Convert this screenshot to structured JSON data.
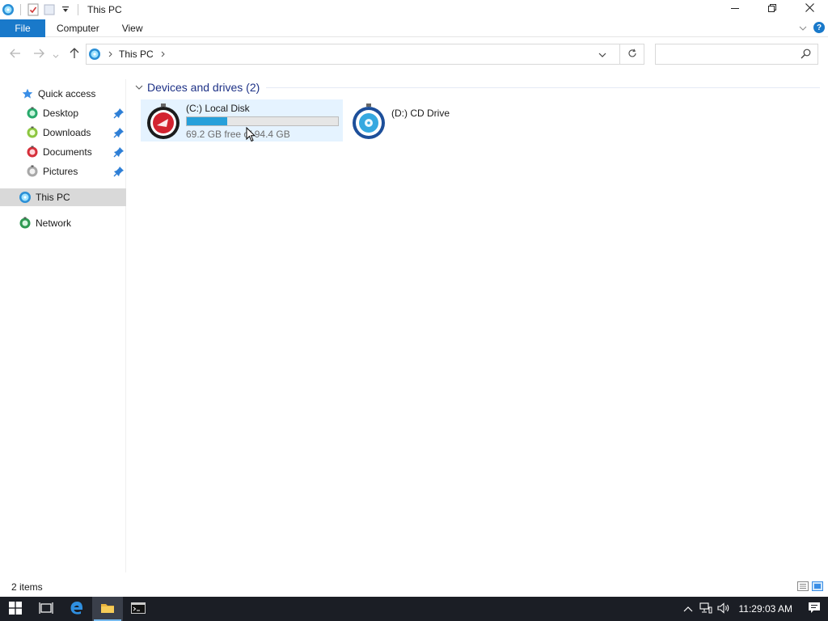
{
  "window": {
    "title": "This PC",
    "icon": "this-pc-icon",
    "controls": [
      "minimize-icon",
      "restore-icon",
      "close-icon"
    ]
  },
  "quick_access_toolbar": {
    "items": [
      "properties-icon",
      "new-folder-icon",
      "customize-dropdown-icon"
    ]
  },
  "ribbon": {
    "tabs": [
      {
        "label": "File",
        "active": true
      },
      {
        "label": "Computer"
      },
      {
        "label": "View"
      }
    ],
    "help_label": "?"
  },
  "address_bar": {
    "segments": [
      "This PC"
    ],
    "search_placeholder": ""
  },
  "nav_pane": {
    "quick_access": "Quick access",
    "pinned": [
      {
        "label": "Desktop",
        "icon": "desktop-icon"
      },
      {
        "label": "Downloads",
        "icon": "downloads-icon"
      },
      {
        "label": "Documents",
        "icon": "documents-icon"
      },
      {
        "label": "Pictures",
        "icon": "pictures-icon"
      }
    ],
    "this_pc": "This PC",
    "network": "Network"
  },
  "content": {
    "group_title": "Devices and drives (2)",
    "drives": [
      {
        "name": "(C:) Local Disk",
        "free_text": "69.2 GB free of 94.4 GB",
        "used_fraction": 0.267,
        "icon": "hard-drive-icon"
      },
      {
        "name": "(D:) CD Drive",
        "icon": "cd-drive-icon"
      }
    ]
  },
  "status_bar": {
    "item_count": "2 items"
  },
  "taskbar": {
    "apps": [
      "start-icon",
      "task-view-icon",
      "edge-icon",
      "file-explorer-icon",
      "cmd-icon"
    ],
    "clock": "11:29:03 AM"
  },
  "colors": {
    "accent": "#1979ca",
    "usage_fill": "#26a0da",
    "selection": "#e5f3ff",
    "taskbar": "#1b1e25"
  }
}
